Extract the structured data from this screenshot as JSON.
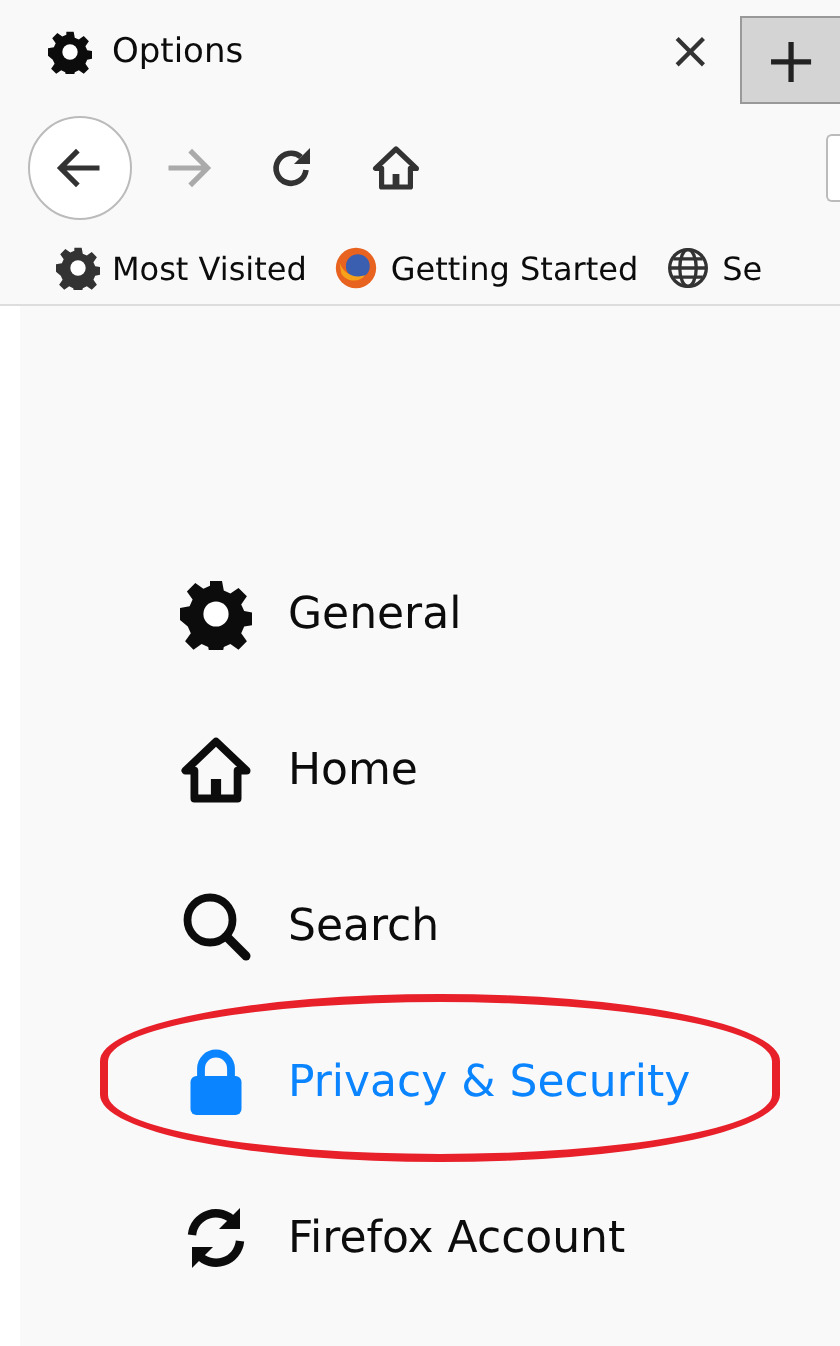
{
  "tab": {
    "title": "Options",
    "close": "×",
    "new_tab": "+"
  },
  "navigation": {
    "back_disabled": false,
    "forward_disabled": true
  },
  "bookmarks": [
    {
      "label": "Most Visited",
      "kind": "gear"
    },
    {
      "label": "Getting Started",
      "kind": "firefox"
    },
    {
      "label": "Se",
      "kind": "globe"
    }
  ],
  "sidebar": {
    "items": [
      {
        "label": "General",
        "kind": "gear",
        "selected": false,
        "highlighted": false
      },
      {
        "label": "Home",
        "kind": "home",
        "selected": false,
        "highlighted": false
      },
      {
        "label": "Search",
        "kind": "search",
        "selected": false,
        "highlighted": false
      },
      {
        "label": "Privacy & Security",
        "kind": "lock",
        "selected": true,
        "highlighted": true
      },
      {
        "label": "Firefox Account",
        "kind": "sync",
        "selected": false,
        "highlighted": false
      }
    ]
  }
}
